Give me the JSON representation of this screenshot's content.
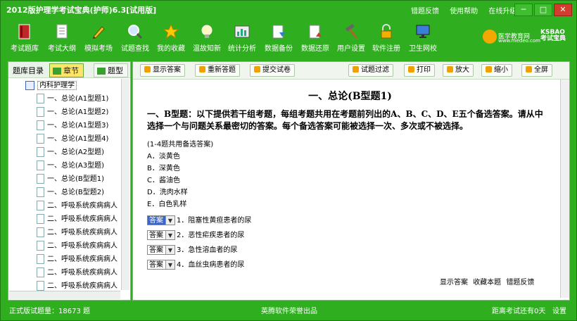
{
  "window": {
    "title": "2012版护理学考试宝典(护师)6.3[试用版]",
    "links": [
      "错题反馈",
      "使用帮助",
      "在线升级"
    ],
    "controls": [
      "─",
      "□",
      "✕"
    ]
  },
  "toolbar": [
    {
      "label": "考试题库",
      "icon": "book-icon"
    },
    {
      "label": "考试大纲",
      "icon": "document-icon"
    },
    {
      "label": "模拟考场",
      "icon": "pencil-icon"
    },
    {
      "label": "试题查找",
      "icon": "magnifier-icon"
    },
    {
      "label": "我的收藏",
      "icon": "star-icon"
    },
    {
      "label": "温故知新",
      "icon": "lightbulb-icon"
    },
    {
      "label": "统计分析",
      "icon": "chart-icon"
    },
    {
      "label": "数据备份",
      "icon": "backup-icon"
    },
    {
      "label": "数据还原",
      "icon": "restore-icon"
    },
    {
      "label": "用户设置",
      "icon": "hammer-icon"
    },
    {
      "label": "软件注册",
      "icon": "lock-icon"
    },
    {
      "label": "卫生网校",
      "icon": "monitor-icon"
    }
  ],
  "brand": {
    "name": "医学教育网",
    "url": "www.medeo.com",
    "right": "KSBAO 考试宝典"
  },
  "left_panel": {
    "label": "题库目录",
    "tab_chapter": "章节",
    "tab_type": "题型",
    "root": "内科护理学",
    "items": [
      "一、总论(A1型题1)",
      "一、总论(A1型题2)",
      "一、总论(A1型题3)",
      "一、总论(A1型题4)",
      "一、总论(A2型题)",
      "一、总论(A3型题)",
      "一、总论(B型题1)",
      "一、总论(B型题2)",
      "二、呼吸系统疾病病人",
      "二、呼吸系统疾病病人",
      "二、呼吸系统疾病病人",
      "二、呼吸系统疾病病人",
      "二、呼吸系统疾病病人",
      "二、呼吸系统疾病病人",
      "二、呼吸系统疾病病人",
      "二、呼吸系统疾病病人"
    ]
  },
  "right_toolbar": {
    "show_answer": "显示答案",
    "redo": "重新答题",
    "submit": "提交试卷",
    "filter": "试题过滤",
    "print": "打印",
    "zoom_in": "放大",
    "zoom_out": "缩小",
    "fullscreen": "全屏"
  },
  "question": {
    "heading": "一、总论(B型题1)",
    "intro": "一、B型题：以下提供若干组考题，每组考题共用在考题前列出的A、B、C、D、E五个备选答案。请从中选择一个与问题关系最密切的答案。每个备选答案可能被选择一次、多次或不被选择。",
    "note": "(1-4题共用备选答案)",
    "options": [
      "A．淡黄色",
      "B．深黄色",
      "C．酱油色",
      "D．洗肉水样",
      "E．白色乳样"
    ],
    "answer_label": "答案",
    "answers": [
      "1．阻塞性黄疸患者的尿",
      "2．恶性疟疾患者的尿",
      "3．急性溶血者的尿",
      "4．血丝虫病患者的尿"
    ],
    "footer_actions": [
      "显示答案",
      "收藏本题",
      "错题反馈"
    ]
  },
  "status": {
    "left": "正式版试题量：18673 题",
    "center": "英腾软件荣誉出品",
    "right": "距离考试还有0天",
    "settings": "设置"
  }
}
